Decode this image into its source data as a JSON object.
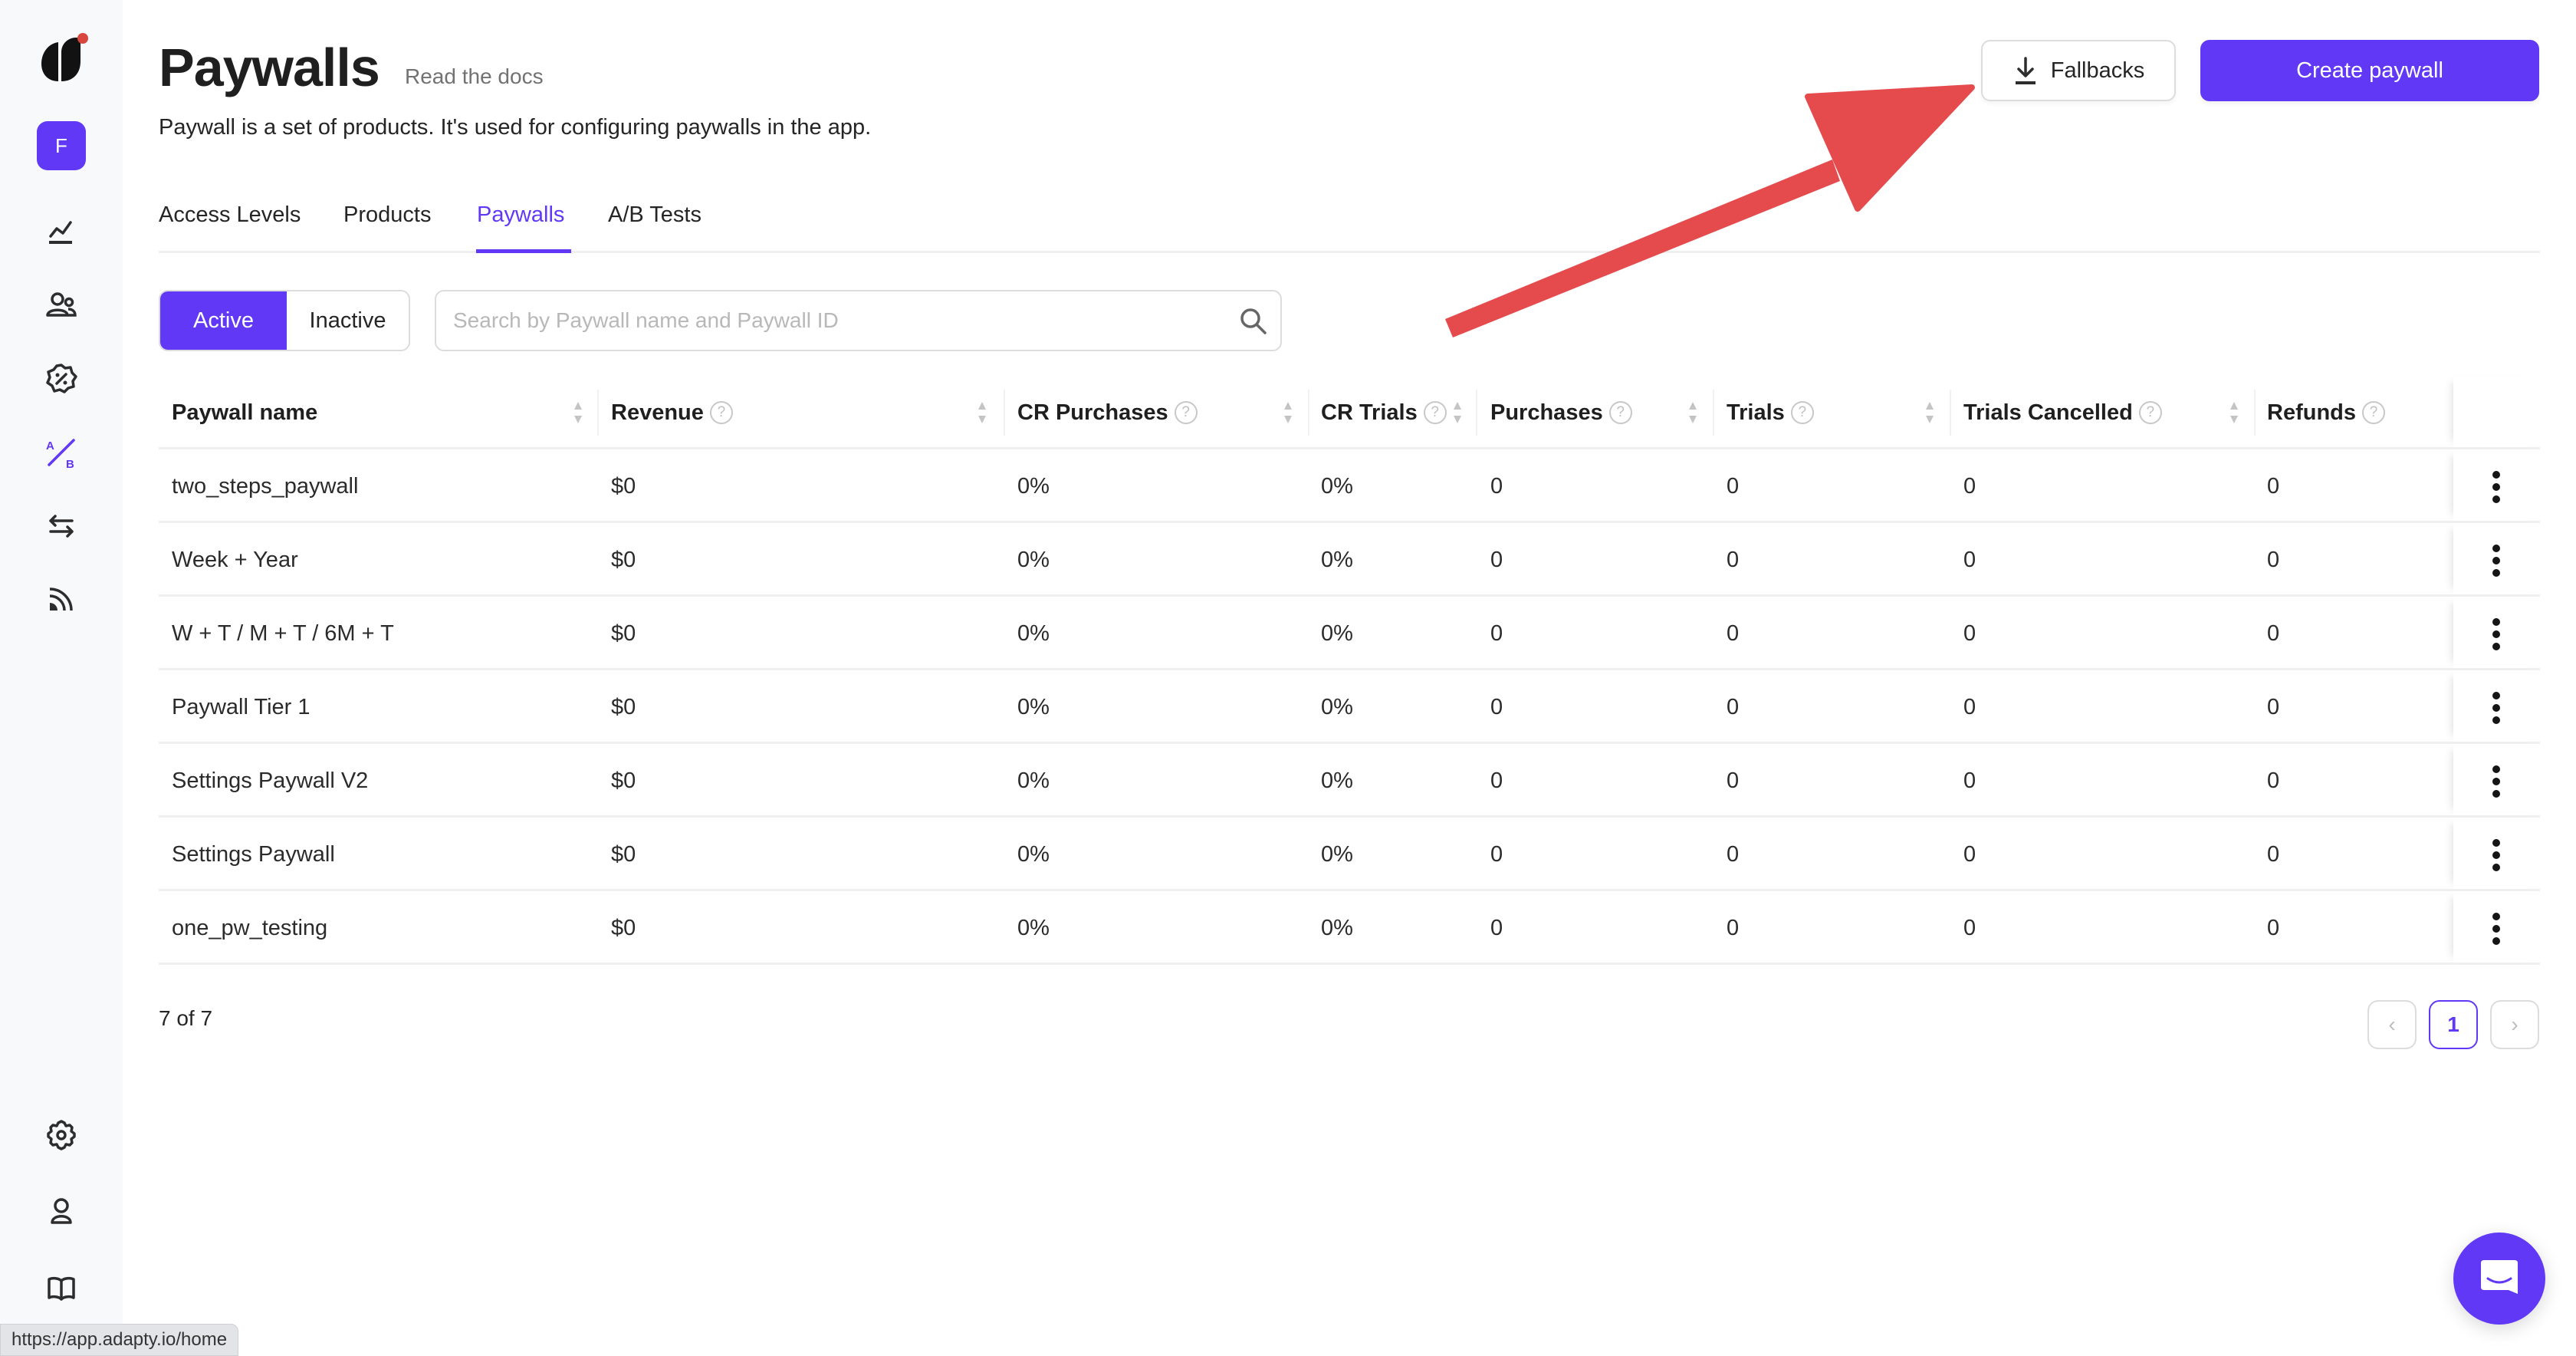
{
  "sidebar": {
    "avatar_letter": "F",
    "top_items": [
      {
        "icon": "analytics-icon",
        "label": "Analytics"
      },
      {
        "icon": "users-icon",
        "label": "Profiles"
      },
      {
        "icon": "promo-badge-icon",
        "label": "Promo"
      },
      {
        "icon": "ab-test-icon",
        "label": "A/B Tests",
        "active": true
      },
      {
        "icon": "transfer-icon",
        "label": "Integrations"
      },
      {
        "icon": "feed-icon",
        "label": "Event feed"
      }
    ],
    "bottom_items": [
      {
        "icon": "gear-icon",
        "label": "Settings"
      },
      {
        "icon": "user-icon",
        "label": "Account"
      },
      {
        "icon": "book-icon",
        "label": "Docs"
      }
    ]
  },
  "header": {
    "title": "Paywalls",
    "docs_link": "Read the docs",
    "subtitle": "Paywall is a set of products. It's used for configuring paywalls in the app.",
    "fallbacks_label": "Fallbacks",
    "create_label": "Create paywall"
  },
  "tabs": [
    {
      "label": "Access Levels",
      "active": false
    },
    {
      "label": "Products",
      "active": false
    },
    {
      "label": "Paywalls",
      "active": true
    },
    {
      "label": "A/B Tests",
      "active": false
    }
  ],
  "filter": {
    "active_label": "Active",
    "inactive_label": "Inactive",
    "search_placeholder": "Search by Paywall name and Paywall ID",
    "search_value": ""
  },
  "table": {
    "columns": [
      {
        "label": "Paywall name",
        "help": false
      },
      {
        "label": "Revenue",
        "help": true
      },
      {
        "label": "CR Purchases",
        "help": true
      },
      {
        "label": "CR Trials",
        "help": true
      },
      {
        "label": "Purchases",
        "help": true
      },
      {
        "label": "Trials",
        "help": true
      },
      {
        "label": "Trials Cancelled",
        "help": true
      },
      {
        "label": "Refunds",
        "help": true
      }
    ],
    "rows": [
      {
        "name": "two_steps_paywall",
        "revenue": "$0",
        "cr_purchases": "0%",
        "cr_trials": "0%",
        "purchases": "0",
        "trials": "0",
        "trials_cancelled": "0",
        "refunds": "0"
      },
      {
        "name": "Week + Year",
        "revenue": "$0",
        "cr_purchases": "0%",
        "cr_trials": "0%",
        "purchases": "0",
        "trials": "0",
        "trials_cancelled": "0",
        "refunds": "0"
      },
      {
        "name": "W + T / M + T / 6M + T",
        "revenue": "$0",
        "cr_purchases": "0%",
        "cr_trials": "0%",
        "purchases": "0",
        "trials": "0",
        "trials_cancelled": "0",
        "refunds": "0"
      },
      {
        "name": "Paywall Tier 1",
        "revenue": "$0",
        "cr_purchases": "0%",
        "cr_trials": "0%",
        "purchases": "0",
        "trials": "0",
        "trials_cancelled": "0",
        "refunds": "0"
      },
      {
        "name": "Settings Paywall V2",
        "revenue": "$0",
        "cr_purchases": "0%",
        "cr_trials": "0%",
        "purchases": "0",
        "trials": "0",
        "trials_cancelled": "0",
        "refunds": "0"
      },
      {
        "name": "Settings Paywall",
        "revenue": "$0",
        "cr_purchases": "0%",
        "cr_trials": "0%",
        "purchases": "0",
        "trials": "0",
        "trials_cancelled": "0",
        "refunds": "0"
      },
      {
        "name": "one_pw_testing",
        "revenue": "$0",
        "cr_purchases": "0%",
        "cr_trials": "0%",
        "purchases": "0",
        "trials": "0",
        "trials_cancelled": "0",
        "refunds": "0"
      }
    ]
  },
  "pagination": {
    "summary": "7 of 7",
    "current_page": "1",
    "prev_symbol": "‹",
    "next_symbol": "›"
  },
  "status_bar": {
    "url": "https://app.adapty.io/home"
  },
  "colors": {
    "accent": "#6038f5",
    "annotation_arrow": "#e54b4d",
    "logo_dot": "#d9463e"
  },
  "annotation": {
    "type": "arrow",
    "points_to": "fallbacks-button"
  }
}
